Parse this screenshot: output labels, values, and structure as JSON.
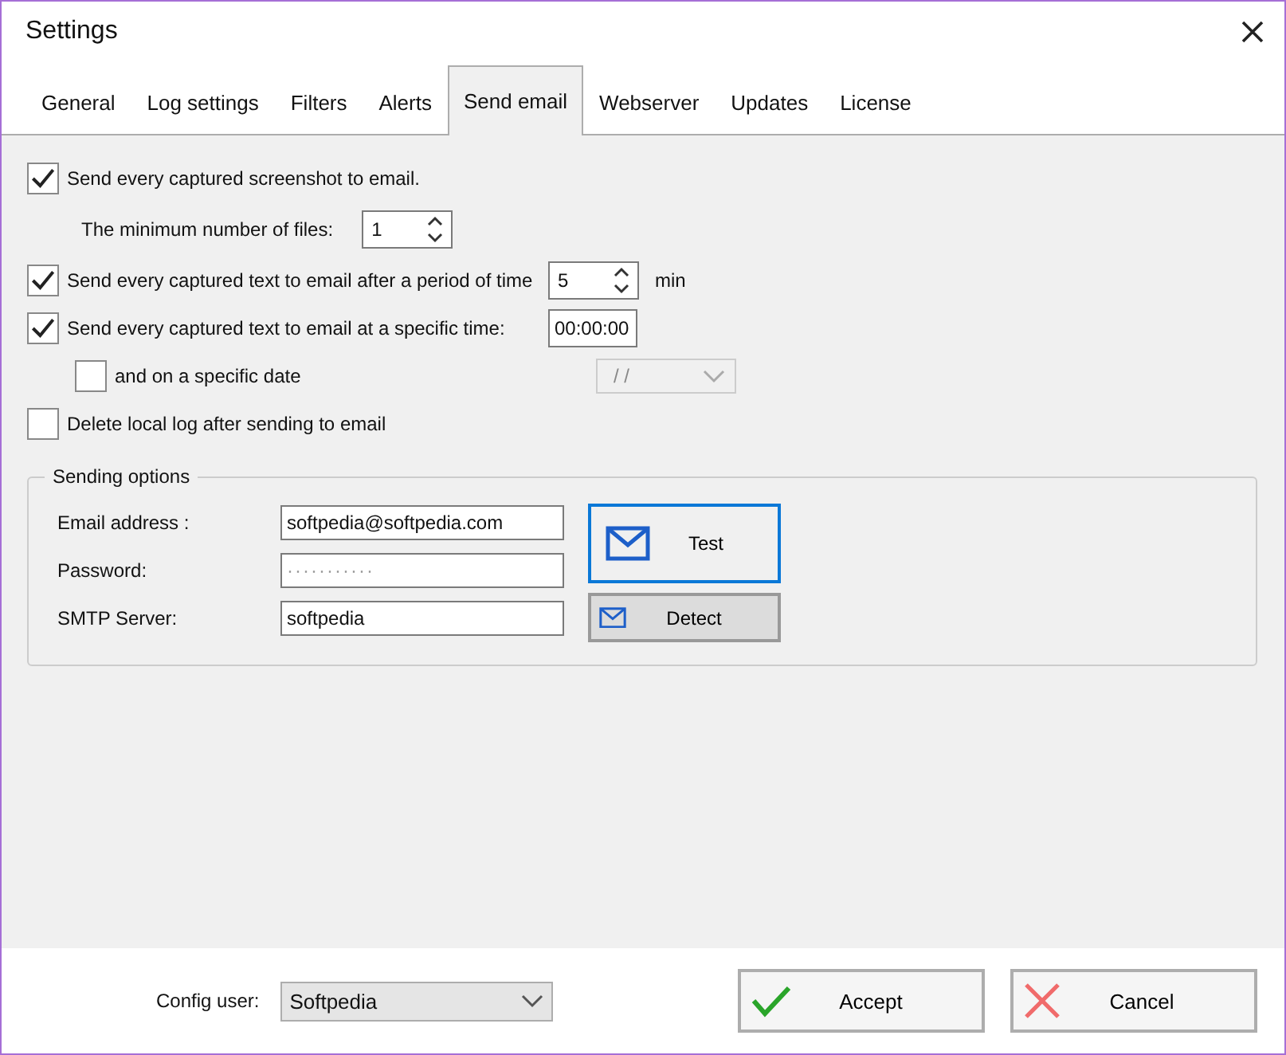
{
  "window": {
    "title": "Settings"
  },
  "tabs": [
    {
      "label": "General",
      "selected": false
    },
    {
      "label": "Log settings",
      "selected": false
    },
    {
      "label": "Filters",
      "selected": false
    },
    {
      "label": "Alerts",
      "selected": false
    },
    {
      "label": "Send email",
      "selected": true
    },
    {
      "label": "Webserver",
      "selected": false
    },
    {
      "label": "Updates",
      "selected": false
    },
    {
      "label": "License",
      "selected": false
    }
  ],
  "options": [
    {
      "label": "Send every captured screenshot to email.",
      "checked": true,
      "children": [
        {
          "kind": "spinner",
          "label": "The minimum number of files:",
          "value": "1"
        }
      ]
    },
    {
      "label": "Send every captured text to email after a period of time",
      "checked": true,
      "control": {
        "kind": "spinner",
        "value": "5",
        "unit": "min"
      }
    },
    {
      "label": "Send every captured text to email at a specific time:",
      "checked": true,
      "control": {
        "kind": "time",
        "value": "00:00:00"
      },
      "children": [
        {
          "kind": "checkbox",
          "label": "and on a specific date",
          "checked": false,
          "control": {
            "kind": "date",
            "value": "/ /",
            "disabled": true
          }
        }
      ]
    },
    {
      "label": "Delete local log after sending to email",
      "checked": false
    }
  ],
  "sending_options": {
    "title": "Sending options",
    "fields": [
      {
        "label": "Email address :",
        "value": "softpedia@softpedia.com"
      },
      {
        "label": "Password:",
        "value": "···········",
        "kind": "password"
      },
      {
        "label": "SMTP Server:",
        "value": "softpedia"
      }
    ],
    "buttons": [
      {
        "label": "Test",
        "focused": true
      },
      {
        "label": "Detect",
        "focused": false
      }
    ]
  },
  "footer": {
    "config_user": {
      "label": "Config user:",
      "value": "Softpedia"
    },
    "buttons": [
      {
        "label": "Accept",
        "kind": "accept"
      },
      {
        "label": "Cancel",
        "kind": "cancel"
      }
    ]
  }
}
